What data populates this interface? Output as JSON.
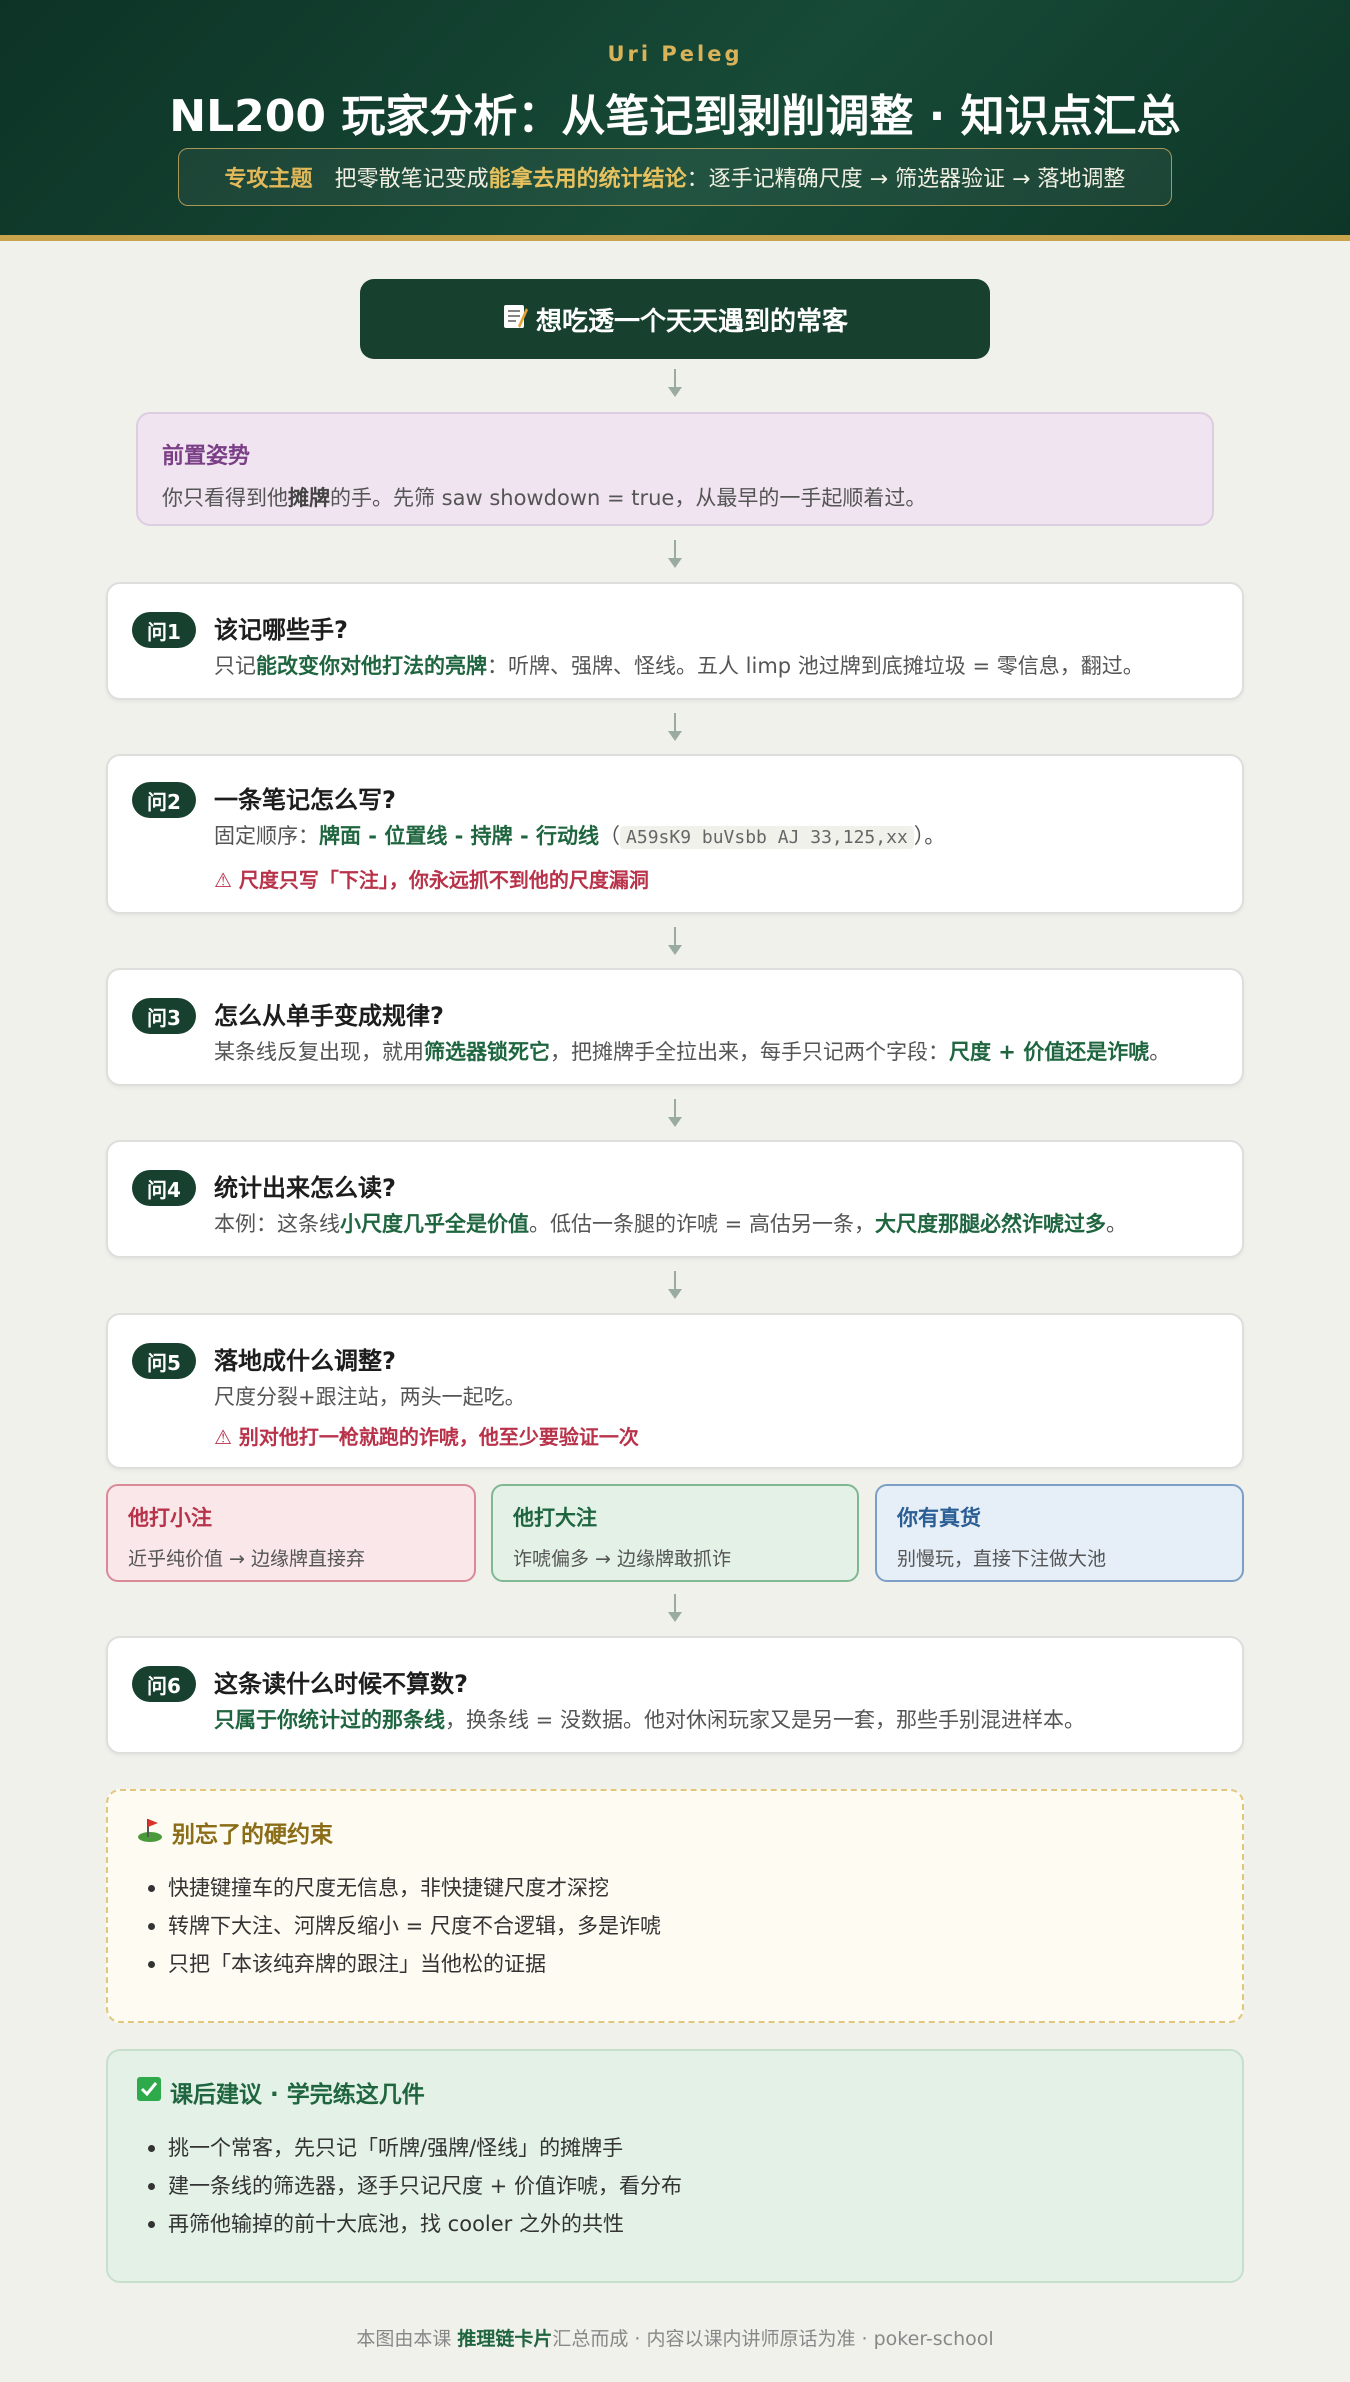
{
  "header": {
    "author": "Uri Peleg",
    "title": "NL200 玩家分析：从笔记到剥削调整 · 知识点汇总",
    "topic_label": "专攻主题",
    "topic_prefix": "把零散笔记变成",
    "topic_emph": "能拿去用的统计结论",
    "topic_suffix": "：逐手记精确尺度 → 筛选器验证 → 落地调整"
  },
  "start": {
    "icon": "memo-icon",
    "text": "想吃透一个天天遇到的常客"
  },
  "pre": {
    "title": "前置姿势",
    "text_a": "你只看得到他",
    "text_b": "摊牌",
    "text_c": "的手。先筛 saw showdown = true，从最早的一手起顺着过。"
  },
  "questions": [
    {
      "badge": "问1",
      "title": "该记哪些手?",
      "text_a": "只记",
      "text_b": "能改变你对他打法的亮牌",
      "text_c": "：听牌、强牌、怪线。五人 limp 池过牌到底摊垃圾 = 零信息，翻过。"
    },
    {
      "badge": "问2",
      "title": "一条笔记怎么写?",
      "text_a": "固定顺序：",
      "text_b": "牌面 - 位置线 - 持牌 - 行动线",
      "text_c": "（",
      "code": "A59sK9 buVsbb AJ 33,125,xx",
      "text_d": "）。",
      "warn": "⚠ 尺度只写「下注」，你永远抓不到他的尺度漏洞"
    },
    {
      "badge": "问3",
      "title": "怎么从单手变成规律?",
      "text_a": "某条线反复出现，就用",
      "text_b": "筛选器锁死它",
      "text_c": "，把摊牌手全拉出来，每手只记两个字段：",
      "text_d": "尺度 + 价值还是诈唬",
      "text_e": "。"
    },
    {
      "badge": "问4",
      "title": "统计出来怎么读?",
      "text_a": "本例：这条线",
      "text_b": "小尺度几乎全是价值",
      "text_c": "。低估一条腿的诈唬 = 高估另一条，",
      "text_d": "大尺度那腿必然诈唬过多",
      "text_e": "。"
    },
    {
      "badge": "问5",
      "title": "落地成什么调整?",
      "text_a": "尺度分裂+跟注站，两头一起吃。",
      "warn": "⚠ 别对他打一枪就跑的诈唬，他至少要验证一次"
    },
    {
      "badge": "问6",
      "title": "这条读什么时候不算数?",
      "text_a": "只属于你统计过的那条线",
      "text_b": "，换条线 = 没数据。他对休闲玩家又是另一套，那些手别混进样本。"
    }
  ],
  "splits": [
    {
      "title": "他打小注",
      "text": "近乎纯价值 → 边缘牌直接弃",
      "color": "#b8324a"
    },
    {
      "title": "他打大注",
      "text": "诈唬偏多 → 边缘牌敢抓诈",
      "color": "#1f6640"
    },
    {
      "title": "你有真货",
      "text": "别慢玩，直接下注做大池",
      "color": "#2b5e95"
    }
  ],
  "notice": {
    "icon": "golf-flag-icon",
    "title": "别忘了的硬约束",
    "items": [
      "快捷键撞车的尺度无信息，非快捷键尺度才深挖",
      "转牌下大注、河牌反缩小 = 尺度不合逻辑，多是诈唬",
      "只把「本该纯弃牌的跟注」当他松的证据"
    ]
  },
  "suggest": {
    "icon": "check-box-icon",
    "title": "课后建议 · 学完练这几件",
    "items": [
      "挑一个常客，先只记「听牌/强牌/怪线」的摊牌手",
      "建一条线的筛选器，逐手只记尺度 + 价值诈唬，看分布",
      "再筛他输掉的前十大底池，找 cooler 之外的共性"
    ]
  },
  "footer": {
    "a": "本图由本课 ",
    "b": "推理链卡片",
    "c": "汇总而成 · 内容以课内讲师原话为准 · poker-school"
  },
  "colors": {
    "header_bg": "#0d3326",
    "gold": "#c9a44c",
    "accent_green": "#1f6640",
    "warn_red": "#b8324a"
  }
}
